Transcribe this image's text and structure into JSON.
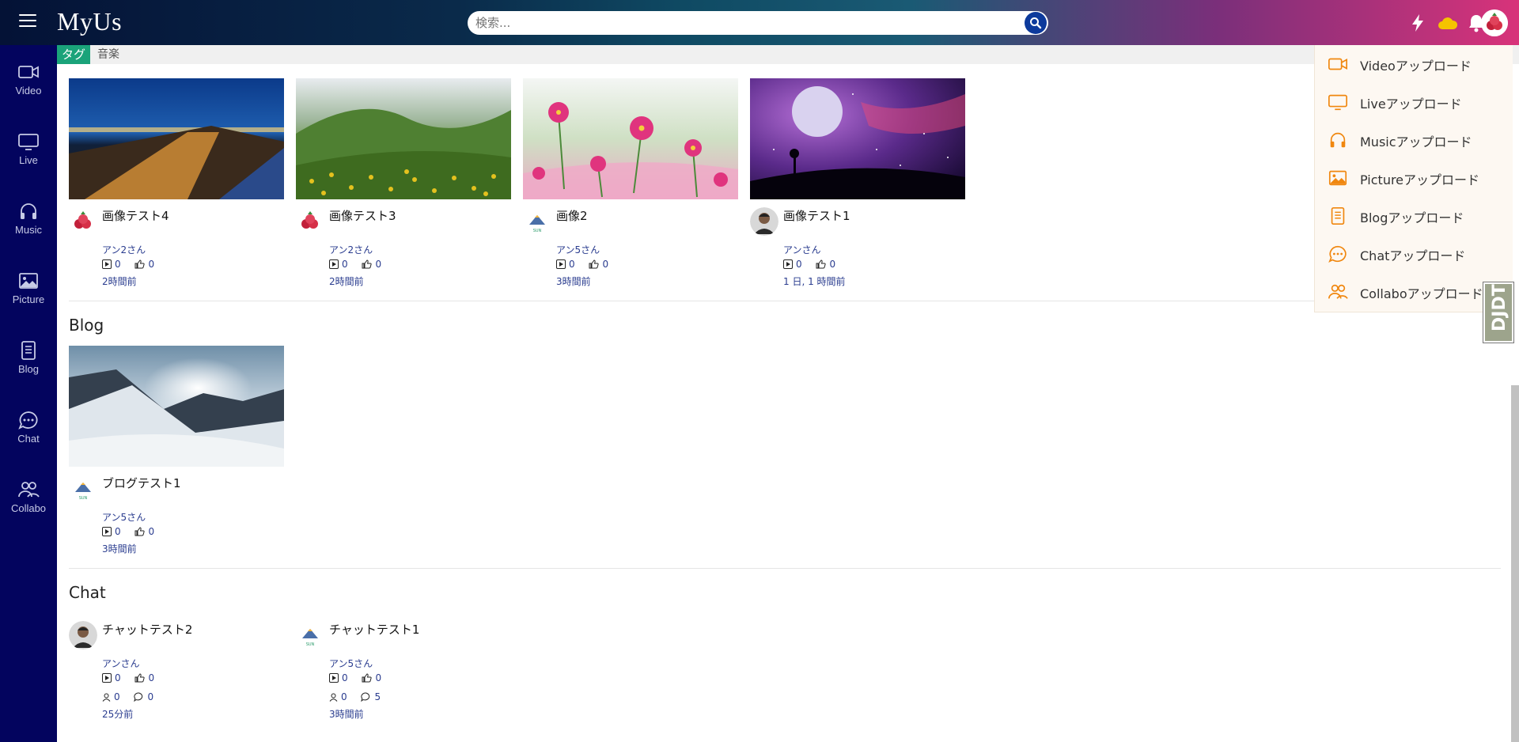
{
  "header": {
    "logo": "MyUs",
    "search_placeholder": "検索..."
  },
  "sidebar": {
    "items": [
      {
        "label": "Video",
        "icon": "video-icon"
      },
      {
        "label": "Live",
        "icon": "monitor-icon"
      },
      {
        "label": "Music",
        "icon": "headphones-icon"
      },
      {
        "label": "Picture",
        "icon": "picture-icon"
      },
      {
        "label": "Blog",
        "icon": "blog-icon"
      },
      {
        "label": "Chat",
        "icon": "chat-icon"
      },
      {
        "label": "Collabo",
        "icon": "collabo-icon"
      }
    ]
  },
  "tagbar": {
    "label": "タグ",
    "value": "音楽"
  },
  "pictures": [
    {
      "title": "画像テスト4",
      "author": "アン2さん",
      "views": "0",
      "likes": "0",
      "time": "2時間前"
    },
    {
      "title": "画像テスト3",
      "author": "アン2さん",
      "views": "0",
      "likes": "0",
      "time": "2時間前"
    },
    {
      "title": "画像2",
      "author": "アン5さん",
      "views": "0",
      "likes": "0",
      "time": "3時間前"
    },
    {
      "title": "画像テスト1",
      "author": "アンさん",
      "views": "0",
      "likes": "0",
      "time": "1 日, 1 時間前"
    }
  ],
  "blog": {
    "section_title": "Blog",
    "items": [
      {
        "title": "ブログテスト1",
        "author": "アン5さん",
        "views": "0",
        "likes": "0",
        "time": "3時間前"
      }
    ]
  },
  "chat": {
    "section_title": "Chat",
    "items": [
      {
        "title": "チャットテスト2",
        "author": "アンさん",
        "views": "0",
        "likes": "0",
        "users": "0",
        "comments": "0",
        "time": "25分前"
      },
      {
        "title": "チャットテスト1",
        "author": "アン5さん",
        "views": "0",
        "likes": "0",
        "users": "0",
        "comments": "5",
        "time": "3時間前"
      }
    ]
  },
  "dropdown": {
    "items": [
      {
        "label": "Videoアップロード",
        "icon": "video-icon"
      },
      {
        "label": "Liveアップロード",
        "icon": "monitor-icon"
      },
      {
        "label": "Musicアップロード",
        "icon": "headphones-icon"
      },
      {
        "label": "Pictureアップロード",
        "icon": "picture-icon"
      },
      {
        "label": "Blogアップロード",
        "icon": "blog-icon"
      },
      {
        "label": "Chatアップロード",
        "icon": "chat-icon"
      },
      {
        "label": "Collaboアップロード",
        "icon": "collabo-icon"
      }
    ]
  },
  "ddt_label": "DJDT",
  "colors": {
    "sidebar_bg": "#03045e",
    "accent_orange": "#f0870f",
    "tag_green": "#1aa37a",
    "meta_blue": "#2a3c8f"
  }
}
